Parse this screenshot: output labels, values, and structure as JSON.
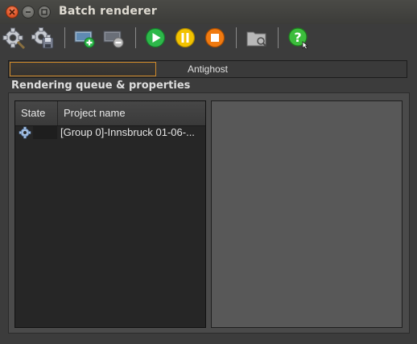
{
  "window": {
    "title": "Batch renderer"
  },
  "toolbar": {
    "buttons": [
      {
        "icon": "settings-gear-icon"
      },
      {
        "icon": "save-settings-icon"
      },
      {
        "icon": "add-project-icon"
      },
      {
        "icon": "remove-project-icon"
      },
      {
        "icon": "play-icon"
      },
      {
        "icon": "pause-icon"
      },
      {
        "icon": "stop-icon"
      },
      {
        "icon": "open-folder-icon"
      },
      {
        "icon": "help-icon"
      }
    ]
  },
  "progress": {
    "label": "Antighost",
    "fraction": 0.37
  },
  "queue": {
    "group_title": "Rendering queue & properties",
    "columns": [
      "State",
      "Project name"
    ],
    "rows": [
      {
        "state_icon": "gear-icon",
        "name": "[Group 0]-Innsbruck 01-06-..."
      }
    ]
  },
  "colors": {
    "accent": "#d08a2a",
    "play": "#2db84a",
    "pause": "#f2c200",
    "stop": "#f07a10",
    "help": "#3cbd3c"
  }
}
